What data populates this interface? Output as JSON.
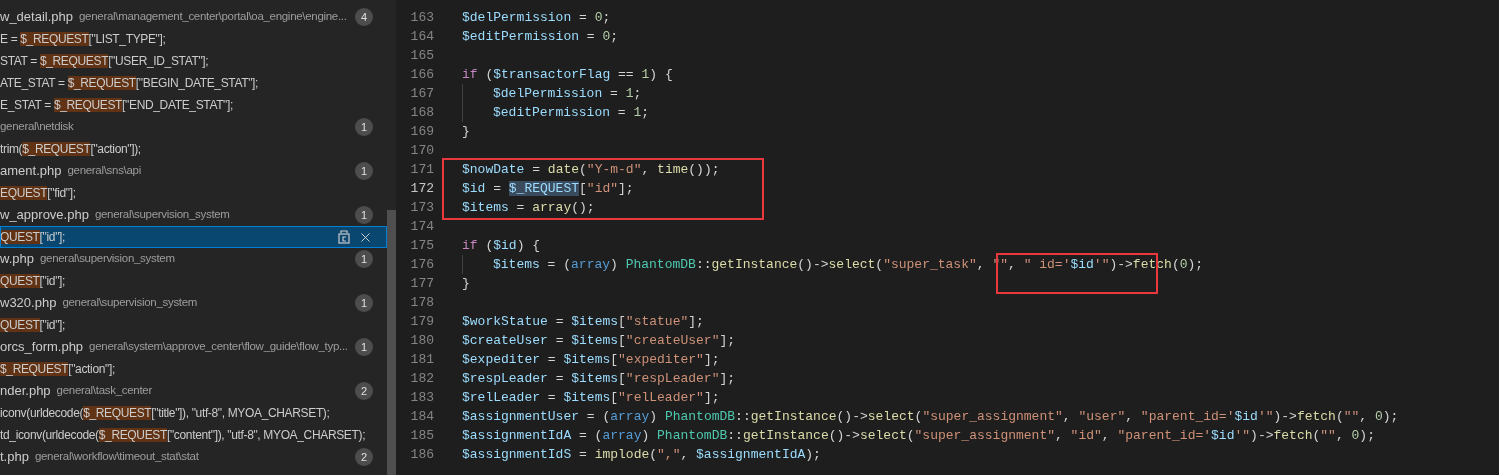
{
  "search_results": {
    "rows": [
      {
        "kind": "file",
        "name": "w_detail.php",
        "path": "general\\management_center\\portal\\oa_engine\\engine...",
        "count": "4",
        "selected": false
      },
      {
        "kind": "match",
        "before": "E = ",
        "match": "$_REQUEST",
        "after": "[\"LIST_TYPE\"];",
        "selected": false
      },
      {
        "kind": "match",
        "before": "STAT = ",
        "match": "$_REQUEST",
        "after": "[\"USER_ID_STAT\"];",
        "selected": false
      },
      {
        "kind": "match",
        "before": "ATE_STAT = ",
        "match": "$_REQUEST",
        "after": "[\"BEGIN_DATE_STAT\"];",
        "selected": false
      },
      {
        "kind": "match",
        "before": "E_STAT = ",
        "match": "$_REQUEST",
        "after": "[\"END_DATE_STAT\"];",
        "selected": false
      },
      {
        "kind": "file",
        "path": "general\\netdisk",
        "count": "1",
        "selected": false
      },
      {
        "kind": "match",
        "before": "trim(",
        "match": "$_REQUEST",
        "after": "[\"action\"]);",
        "selected": false
      },
      {
        "kind": "file",
        "name": "ament.php",
        "path": "general\\sns\\api",
        "count": "1",
        "selected": false
      },
      {
        "kind": "match",
        "match": "EQUEST",
        "after": "[\"fid\"];",
        "selected": false
      },
      {
        "kind": "file",
        "name": "w_approve.php",
        "path": "general\\supervision_system",
        "count": "1",
        "selected": false
      },
      {
        "kind": "match",
        "match": "QUEST",
        "after": "[\"id\"];",
        "selected": true
      },
      {
        "kind": "file",
        "name": "w.php",
        "path": "general\\supervision_system",
        "count": "1",
        "selected": false
      },
      {
        "kind": "match",
        "match": "QUEST",
        "after": "[\"id\"];",
        "selected": false
      },
      {
        "kind": "file",
        "name": "w320.php",
        "path": "general\\supervision_system",
        "count": "1",
        "selected": false
      },
      {
        "kind": "match",
        "match": "QUEST",
        "after": "[\"id\"];",
        "selected": false
      },
      {
        "kind": "file",
        "name": "orcs_form.php",
        "path": "general\\system\\approve_center\\flow_guide\\flow_typ...",
        "count": "1",
        "selected": false
      },
      {
        "kind": "match",
        "match": "$_REQUEST",
        "after": "[\"action\"];",
        "selected": false
      },
      {
        "kind": "file",
        "name": "nder.php",
        "path": "general\\task_center",
        "count": "2",
        "selected": false
      },
      {
        "kind": "match",
        "before": "iconv(urldecode(",
        "match": "$_REQUEST",
        "after": "[\"title\"]), \"utf-8\", MYOA_CHARSET);",
        "selected": false
      },
      {
        "kind": "match",
        "before": "td_iconv(urldecode(",
        "match": "$_REQUEST",
        "after": "[\"content\"]), \"utf-8\", MYOA_CHARSET);",
        "selected": false
      },
      {
        "kind": "file",
        "name": "t.php",
        "path": "general\\workflow\\timeout_stat\\stat",
        "count": "2",
        "selected": false
      }
    ]
  },
  "editor": {
    "blocks": [
      {
        "lines": [
          {
            "number": "163",
            "tokens": [
              {
                "text": "$delPermission",
                "kind": "var"
              },
              {
                "text": " = ",
                "kind": "p"
              },
              {
                "text": "0",
                "kind": "num"
              },
              {
                "text": ";",
                "kind": "p"
              }
            ]
          },
          {
            "number": "164",
            "tokens": [
              {
                "text": "$editPermission",
                "kind": "var"
              },
              {
                "text": " = ",
                "kind": "p"
              },
              {
                "text": "0",
                "kind": "num"
              },
              {
                "text": ";",
                "kind": "p"
              }
            ]
          },
          {
            "number": "165"
          },
          {
            "number": "166",
            "tokens": [
              {
                "text": "if",
                "kind": "kw"
              },
              {
                "text": " (",
                "kind": "p"
              },
              {
                "text": "$transactorFlag",
                "kind": "var"
              },
              {
                "text": " == ",
                "kind": "p"
              },
              {
                "text": "1",
                "kind": "num"
              },
              {
                "text": ") {",
                "kind": "p"
              }
            ]
          },
          {
            "number": "167",
            "indent": true,
            "tokens": [
              {
                "text": "$delPermission",
                "kind": "var"
              },
              {
                "text": " = ",
                "kind": "p"
              },
              {
                "text": "1",
                "kind": "num"
              },
              {
                "text": ";",
                "kind": "p"
              }
            ]
          },
          {
            "number": "168",
            "indent": true,
            "tokens": [
              {
                "text": "$editPermission",
                "kind": "var"
              },
              {
                "text": " = ",
                "kind": "p"
              },
              {
                "text": "1",
                "kind": "num"
              },
              {
                "text": ";",
                "kind": "p"
              }
            ]
          },
          {
            "number": "169",
            "tokens": [
              {
                "text": "}",
                "kind": "p"
              }
            ]
          },
          {
            "number": "170"
          }
        ]
      },
      {
        "outlined": true,
        "lines": [
          {
            "number": "171",
            "tokens": [
              {
                "text": "$nowDate",
                "kind": "var"
              },
              {
                "text": " = ",
                "kind": "p"
              },
              {
                "text": "date",
                "kind": "fn"
              },
              {
                "text": "(",
                "kind": "p"
              },
              {
                "text": "\"Y-m-d\"",
                "kind": "str"
              },
              {
                "text": ", ",
                "kind": "p"
              },
              {
                "text": "time",
                "kind": "fn"
              },
              {
                "text": "());",
                "kind": "p"
              }
            ]
          },
          {
            "number": "172",
            "current": true,
            "tokens": [
              {
                "text": "$id",
                "kind": "var"
              },
              {
                "text": " = ",
                "kind": "p"
              },
              {
                "text": "$_REQUEST",
                "kind": "var",
                "highlighted": true
              },
              {
                "text": "[",
                "kind": "p"
              },
              {
                "text": "\"id\"",
                "kind": "str"
              },
              {
                "text": "];",
                "kind": "p"
              }
            ]
          },
          {
            "number": "173",
            "tokens": [
              {
                "text": "$items",
                "kind": "var"
              },
              {
                "text": " = ",
                "kind": "p"
              },
              {
                "text": "array",
                "kind": "fn"
              },
              {
                "text": "();",
                "kind": "p"
              }
            ]
          }
        ]
      },
      {
        "lines": [
          {
            "number": "174"
          },
          {
            "number": "175",
            "tokens": [
              {
                "text": "if",
                "kind": "kw"
              },
              {
                "text": " (",
                "kind": "p"
              },
              {
                "text": "$id",
                "kind": "var"
              },
              {
                "text": ") {",
                "kind": "p"
              }
            ]
          },
          {
            "number": "176",
            "indent": true,
            "tokens": [
              {
                "text": "$items",
                "kind": "var"
              },
              {
                "text": " = (",
                "kind": "p"
              },
              {
                "text": "array",
                "kind": "type"
              },
              {
                "text": ") ",
                "kind": "p"
              },
              {
                "text": "PhantomDB",
                "kind": "cls"
              },
              {
                "text": "::",
                "kind": "p"
              },
              {
                "text": "getInstance",
                "kind": "fn"
              },
              {
                "text": "()->",
                "kind": "p"
              },
              {
                "text": "select",
                "kind": "fn"
              },
              {
                "text": "(",
                "kind": "p"
              },
              {
                "text": "\"super_task\"",
                "kind": "str"
              },
              {
                "text": ", ",
                "kind": "p"
              },
              {
                "text": "\"",
                "kind": "str"
              },
              {
                "kind": "group",
                "outlined": true,
                "tokens": [
                  {
                    "text": "\"",
                    "kind": "str"
                  },
                  {
                    "text": ", ",
                    "kind": "p"
                  },
                  {
                    "text": "\" id='",
                    "kind": "str"
                  },
                  {
                    "text": "$id",
                    "kind": "var"
                  },
                  {
                    "text": "'\"",
                    "kind": "str"
                  },
                  {
                    "text": ")->",
                    "kind": "p"
                  },
                  {
                    "text": "fet",
                    "kind": "fn"
                  }
                ]
              },
              {
                "text": "ch",
                "kind": "fn"
              },
              {
                "text": "(",
                "kind": "p"
              },
              {
                "text": "0",
                "kind": "num"
              },
              {
                "text": ");",
                "kind": "p"
              }
            ]
          },
          {
            "number": "177",
            "tokens": [
              {
                "text": "}",
                "kind": "p"
              }
            ]
          },
          {
            "number": "178"
          },
          {
            "number": "179",
            "tokens": [
              {
                "text": "$workStatue",
                "kind": "var"
              },
              {
                "text": " = ",
                "kind": "p"
              },
              {
                "text": "$items",
                "kind": "var"
              },
              {
                "text": "[",
                "kind": "p"
              },
              {
                "text": "\"statue\"",
                "kind": "str"
              },
              {
                "text": "];",
                "kind": "p"
              }
            ]
          },
          {
            "number": "180",
            "tokens": [
              {
                "text": "$createUser",
                "kind": "var"
              },
              {
                "text": " = ",
                "kind": "p"
              },
              {
                "text": "$items",
                "kind": "var"
              },
              {
                "text": "[",
                "kind": "p"
              },
              {
                "text": "\"createUser\"",
                "kind": "str"
              },
              {
                "text": "];",
                "kind": "p"
              }
            ]
          },
          {
            "number": "181",
            "tokens": [
              {
                "text": "$expediter",
                "kind": "var"
              },
              {
                "text": " = ",
                "kind": "p"
              },
              {
                "text": "$items",
                "kind": "var"
              },
              {
                "text": "[",
                "kind": "p"
              },
              {
                "text": "\"expediter\"",
                "kind": "str"
              },
              {
                "text": "];",
                "kind": "p"
              }
            ]
          },
          {
            "number": "182",
            "tokens": [
              {
                "text": "$respLeader",
                "kind": "var"
              },
              {
                "text": " = ",
                "kind": "p"
              },
              {
                "text": "$items",
                "kind": "var"
              },
              {
                "text": "[",
                "kind": "p"
              },
              {
                "text": "\"respLeader\"",
                "kind": "str"
              },
              {
                "text": "];",
                "kind": "p"
              }
            ]
          },
          {
            "number": "183",
            "tokens": [
              {
                "text": "$relLeader",
                "kind": "var"
              },
              {
                "text": " = ",
                "kind": "p"
              },
              {
                "text": "$items",
                "kind": "var"
              },
              {
                "text": "[",
                "kind": "p"
              },
              {
                "text": "\"relLeader\"",
                "kind": "str"
              },
              {
                "text": "];",
                "kind": "p"
              }
            ]
          },
          {
            "number": "184",
            "tokens": [
              {
                "text": "$assignmentUser",
                "kind": "var"
              },
              {
                "text": " = (",
                "kind": "p"
              },
              {
                "text": "array",
                "kind": "type"
              },
              {
                "text": ") ",
                "kind": "p"
              },
              {
                "text": "PhantomDB",
                "kind": "cls"
              },
              {
                "text": "::",
                "kind": "p"
              },
              {
                "text": "getInstance",
                "kind": "fn"
              },
              {
                "text": "()->",
                "kind": "p"
              },
              {
                "text": "select",
                "kind": "fn"
              },
              {
                "text": "(",
                "kind": "p"
              },
              {
                "text": "\"super_assignment\"",
                "kind": "str"
              },
              {
                "text": ", ",
                "kind": "p"
              },
              {
                "text": "\"user\"",
                "kind": "str"
              },
              {
                "text": ", ",
                "kind": "p"
              },
              {
                "text": "\"parent_id='",
                "kind": "str"
              },
              {
                "text": "$id",
                "kind": "var"
              },
              {
                "text": "'\"",
                "kind": "str"
              },
              {
                "text": ")->",
                "kind": "p"
              },
              {
                "text": "fetch",
                "kind": "fn"
              },
              {
                "text": "(",
                "kind": "p"
              },
              {
                "text": "\"\"",
                "kind": "str"
              },
              {
                "text": ", ",
                "kind": "p"
              },
              {
                "text": "0",
                "kind": "num"
              },
              {
                "text": ");",
                "kind": "p"
              }
            ]
          },
          {
            "number": "185",
            "tokens": [
              {
                "text": "$assignmentIdA",
                "kind": "var"
              },
              {
                "text": " = (",
                "kind": "p"
              },
              {
                "text": "array",
                "kind": "type"
              },
              {
                "text": ") ",
                "kind": "p"
              },
              {
                "text": "PhantomDB",
                "kind": "cls"
              },
              {
                "text": "::",
                "kind": "p"
              },
              {
                "text": "getInstance",
                "kind": "fn"
              },
              {
                "text": "()->",
                "kind": "p"
              },
              {
                "text": "select",
                "kind": "fn"
              },
              {
                "text": "(",
                "kind": "p"
              },
              {
                "text": "\"super_assignment\"",
                "kind": "str"
              },
              {
                "text": ", ",
                "kind": "p"
              },
              {
                "text": "\"id\"",
                "kind": "str"
              },
              {
                "text": ", ",
                "kind": "p"
              },
              {
                "text": "\"parent_id='",
                "kind": "str"
              },
              {
                "text": "$id",
                "kind": "var"
              },
              {
                "text": "'\"",
                "kind": "str"
              },
              {
                "text": ")->",
                "kind": "p"
              },
              {
                "text": "fetch",
                "kind": "fn"
              },
              {
                "text": "(",
                "kind": "p"
              },
              {
                "text": "\"\"",
                "kind": "str"
              },
              {
                "text": ", ",
                "kind": "p"
              },
              {
                "text": "0",
                "kind": "num"
              },
              {
                "text": ");",
                "kind": "p"
              }
            ]
          },
          {
            "number": "186",
            "tokens": [
              {
                "text": "$assignmentIdS",
                "kind": "var"
              },
              {
                "text": " = ",
                "kind": "p"
              },
              {
                "text": "implode",
                "kind": "fn"
              },
              {
                "text": "(",
                "kind": "p"
              },
              {
                "text": "\",\"",
                "kind": "str"
              },
              {
                "text": ", ",
                "kind": "p"
              },
              {
                "text": "$assignmentIdA",
                "kind": "var"
              },
              {
                "text": ");",
                "kind": "p"
              }
            ]
          }
        ]
      }
    ]
  }
}
